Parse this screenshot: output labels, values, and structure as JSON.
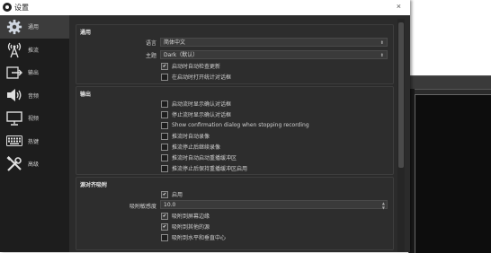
{
  "window": {
    "title": "设置",
    "close_glyph": "×"
  },
  "sidebar": {
    "items": [
      {
        "label": "通用",
        "icon": "gear-icon",
        "active": true
      },
      {
        "label": "推流",
        "icon": "broadcast-icon",
        "active": false
      },
      {
        "label": "输出",
        "icon": "output-icon",
        "active": false
      },
      {
        "label": "音频",
        "icon": "speaker-icon",
        "active": false
      },
      {
        "label": "视频",
        "icon": "monitor-icon",
        "active": false
      },
      {
        "label": "热键",
        "icon": "keyboard-icon",
        "active": false
      },
      {
        "label": "高级",
        "icon": "tools-icon",
        "active": false
      }
    ]
  },
  "general": {
    "title": "通用",
    "language_label": "语言",
    "language_value": "简体中文",
    "theme_label": "主题",
    "theme_value": "Dark（默认）",
    "checks": [
      {
        "label": "启动时自动检查更新",
        "checked": true
      },
      {
        "label": "在启动时打开统计对话框",
        "checked": false
      }
    ]
  },
  "output": {
    "title": "输出",
    "checks": [
      {
        "label": "启动流时显示确认对话框",
        "checked": false
      },
      {
        "label": "停止流时显示确认对话框",
        "checked": false
      },
      {
        "label": "Show confirmation dialog when stopping recording",
        "checked": false
      },
      {
        "label": "推流时自动录像",
        "checked": false
      },
      {
        "label": "推流停止后继续录像",
        "checked": false
      },
      {
        "label": "推流时自动启动重播缓冲区",
        "checked": false
      },
      {
        "label": "推流停止后保持重播缓冲区启用",
        "checked": false
      }
    ]
  },
  "snapping": {
    "title": "源对齐吸附",
    "enable_label": "启用",
    "enable_checked": true,
    "sensitivity_label": "吸附敏感度",
    "sensitivity_value": "10.0",
    "checks": [
      {
        "label": "吸附到屏幕边缘",
        "checked": true
      },
      {
        "label": "吸附到其他的源",
        "checked": true
      },
      {
        "label": "吸附到水平和垂直中心",
        "checked": false
      }
    ]
  },
  "colors": {
    "window_bg": "#2b2b2b",
    "sidebar_bg": "#1d1d1d",
    "active_item": "#3c3c3c"
  }
}
